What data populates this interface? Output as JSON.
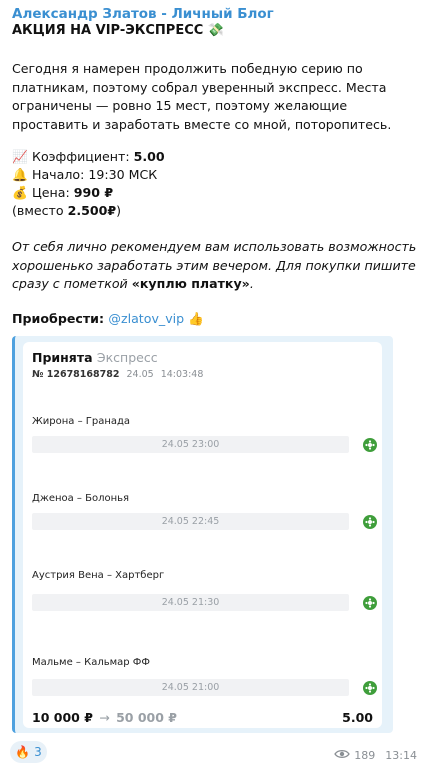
{
  "channel_name": "Александр Златов - Личный Блог",
  "post_title": "АКЦИЯ НА VIP-ЭКСПРЕСС 💸",
  "intro_text": "Сегодня я намерен продолжить победную серию по платникам, поэтому собрал уверенный экспресс. Места ограничены — ровно 15 мест, поэтому желающие проставить и заработать вместе со мной, поторопитесь.",
  "details": {
    "coef_emoji": "📈",
    "coef_label": "Коэффициент: ",
    "coef_value": "5.00",
    "start_emoji": "🔔",
    "start_label": "Начало: 19:30 МСК",
    "price_emoji": "💰",
    "price_label": "Цена: ",
    "price_value": "990 ₽",
    "instead_prefix": "(вместо ",
    "instead_value": "2.500₽",
    "instead_suffix": ")"
  },
  "recommend_text": "От себя лично рекомендуем вам использовать возможность хорошенько заработать этим вечером. Для покупки пишите сразу с пометкой ",
  "recommend_quote": "«куплю платку»",
  "recommend_end": ".",
  "buy_label": "Приобрести: ",
  "buy_link": "@zlatov_vip",
  "buy_emoji": "👍",
  "bet_card": {
    "status": "Принята",
    "kind": "Экспресс",
    "number": "№ 12678168782",
    "date": "24.05",
    "time": "14:03:48",
    "matches": [
      {
        "teams": "Жирона – Гранада",
        "datetime": "24.05 23:00"
      },
      {
        "teams": "Дженоа – Болонья",
        "datetime": "24.05 22:45"
      },
      {
        "teams": "Аустрия Вена – Хартберг",
        "datetime": "24.05 21:30"
      },
      {
        "teams": "Мальме – Кальмар ФФ",
        "datetime": "24.05 21:00"
      }
    ],
    "stake": "10 000 ₽",
    "arrow": "→",
    "win": "50 000 ₽",
    "total_coef": "5.00",
    "status_icon_color": "#3f9e3b"
  },
  "reaction": {
    "emoji": "🔥",
    "count": "3"
  },
  "views": "189",
  "post_time": "13:14",
  "colors": {
    "accent": "#3a8fd1",
    "chat_background": "#dff0d3"
  }
}
